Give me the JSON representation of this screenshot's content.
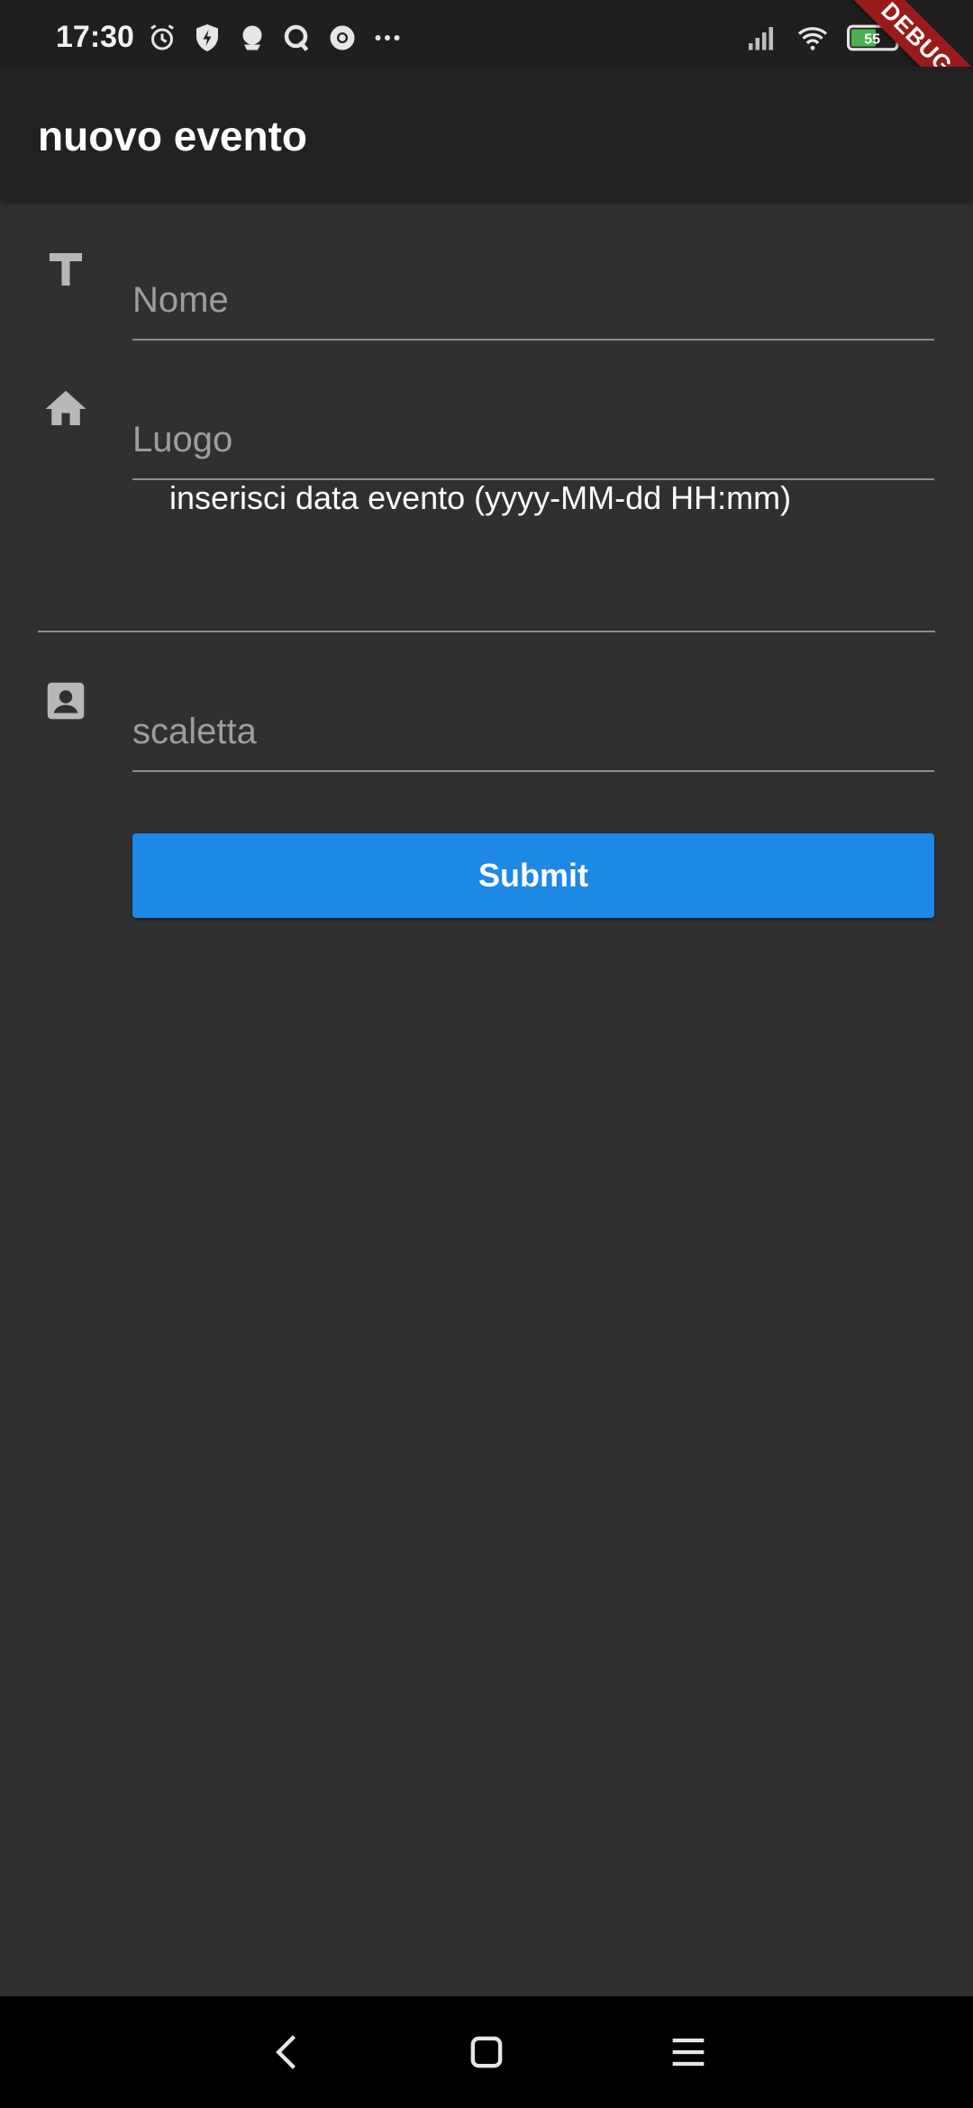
{
  "status_bar": {
    "time": "17:30",
    "battery_level": "55",
    "left_icons": [
      "alarm-icon",
      "shield-bolt-icon",
      "owl-icon",
      "q-icon",
      "chrome-icon",
      "more-dots-icon"
    ],
    "right_icons": [
      "signal-icon",
      "wifi-icon",
      "battery-icon"
    ]
  },
  "debug_banner": "DEBUG",
  "app_bar": {
    "title": "nuovo evento"
  },
  "form": {
    "name_field": {
      "placeholder": "Nome",
      "value": "",
      "icon": "text-t-icon"
    },
    "place_field": {
      "placeholder": "Luogo",
      "value": "",
      "icon": "home-icon"
    },
    "date_field": {
      "label": "inserisci data evento (yyyy-MM-dd HH:mm)",
      "value": ""
    },
    "setlist_field": {
      "placeholder": "scaletta",
      "value": "",
      "icon": "contact-icon"
    },
    "submit_label": "Submit"
  },
  "colors": {
    "background": "#303030",
    "app_bar": "#212121",
    "accent": "#1e88e5",
    "debug_ribbon": "#9b1b1b"
  },
  "nav_bar": {
    "buttons": [
      "back-icon",
      "home-square-icon",
      "menu-icon"
    ]
  }
}
